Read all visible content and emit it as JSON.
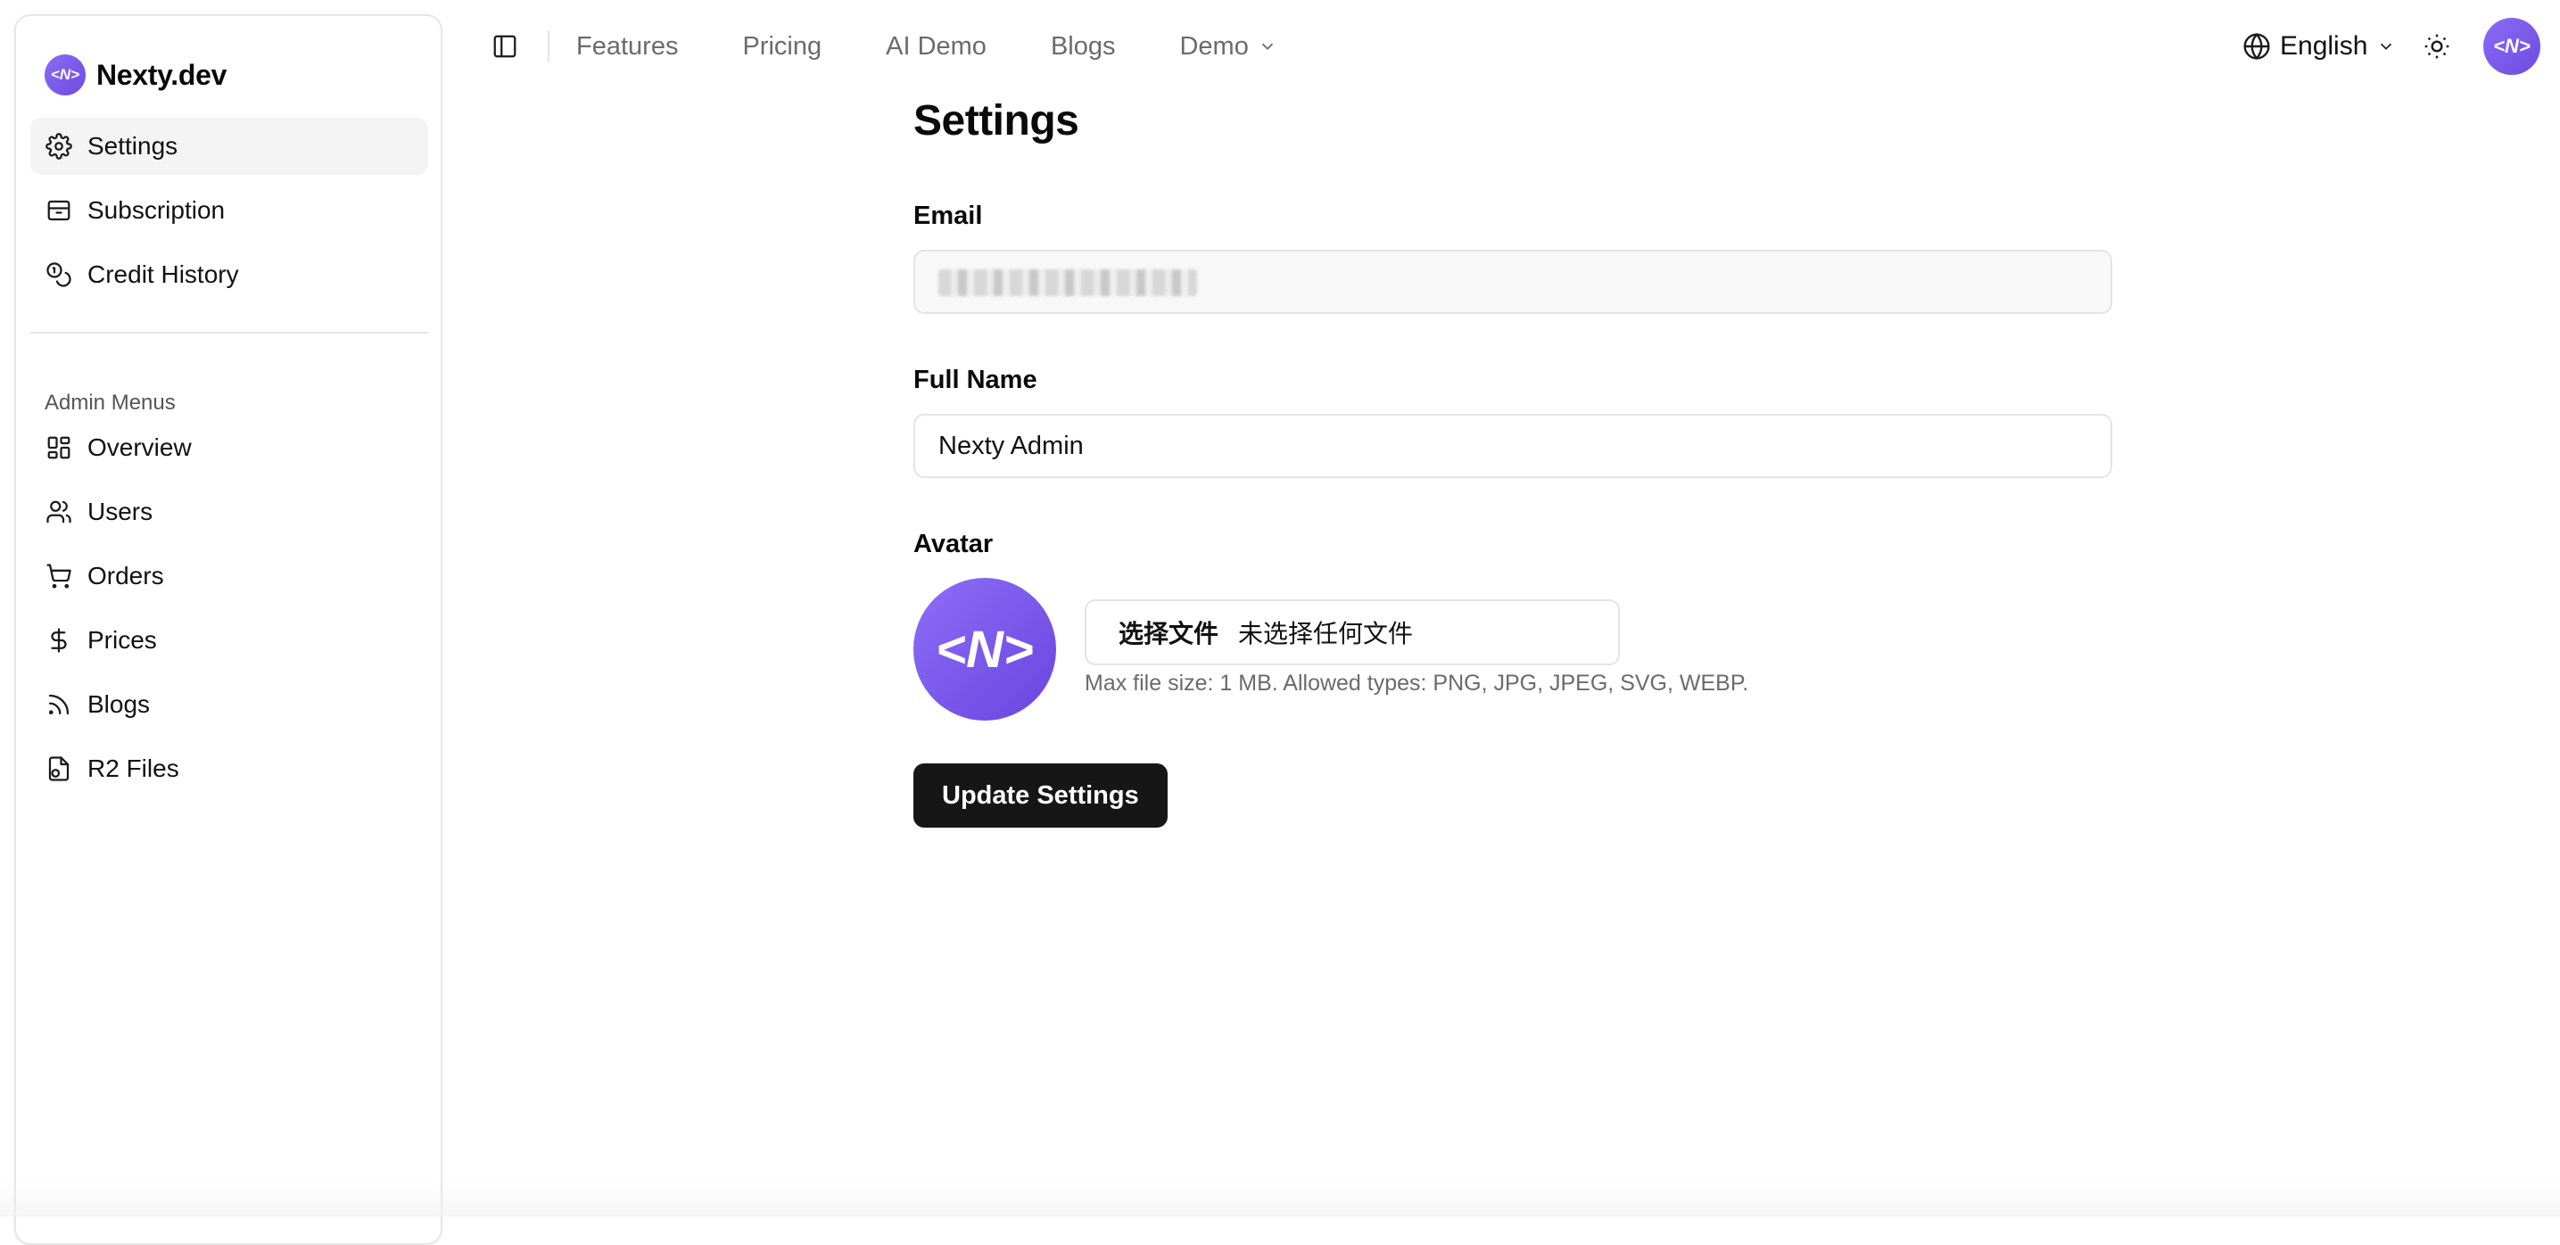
{
  "brand": {
    "logo_text": "<N>",
    "name": "Nexty.dev"
  },
  "sidebar": {
    "user_items": [
      {
        "label": "Settings",
        "icon": "gear-icon",
        "active": true
      },
      {
        "label": "Subscription",
        "icon": "archive-box-icon",
        "active": false
      },
      {
        "label": "Credit History",
        "icon": "coins-icon",
        "active": false
      }
    ],
    "admin_section_label": "Admin Menus",
    "admin_items": [
      {
        "label": "Overview",
        "icon": "dashboard-grid-icon"
      },
      {
        "label": "Users",
        "icon": "users-icon"
      },
      {
        "label": "Orders",
        "icon": "shopping-cart-icon"
      },
      {
        "label": "Prices",
        "icon": "dollar-sign-icon"
      },
      {
        "label": "Blogs",
        "icon": "rss-icon"
      },
      {
        "label": "R2 Files",
        "icon": "file-icon"
      }
    ]
  },
  "topnav": {
    "links": [
      "Features",
      "Pricing",
      "AI Demo",
      "Blogs"
    ],
    "demo_label": "Demo",
    "language": "English",
    "avatar_text": "<N>"
  },
  "page": {
    "title": "Settings",
    "email_label": "Email",
    "email_value": "",
    "fullname_label": "Full Name",
    "fullname_value": "Nexty Admin",
    "avatar_label": "Avatar",
    "avatar_text": "<N>",
    "file_choose_label": "选择文件",
    "file_none_label": "未选择任何文件",
    "file_hint": "Max file size: 1 MB. Allowed types: PNG, JPG, JPEG, SVG, WEBP.",
    "submit_label": "Update Settings"
  },
  "colors": {
    "accent": "#7c5cf0",
    "active_bg": "#f4f4f5",
    "button_bg": "#161616"
  }
}
